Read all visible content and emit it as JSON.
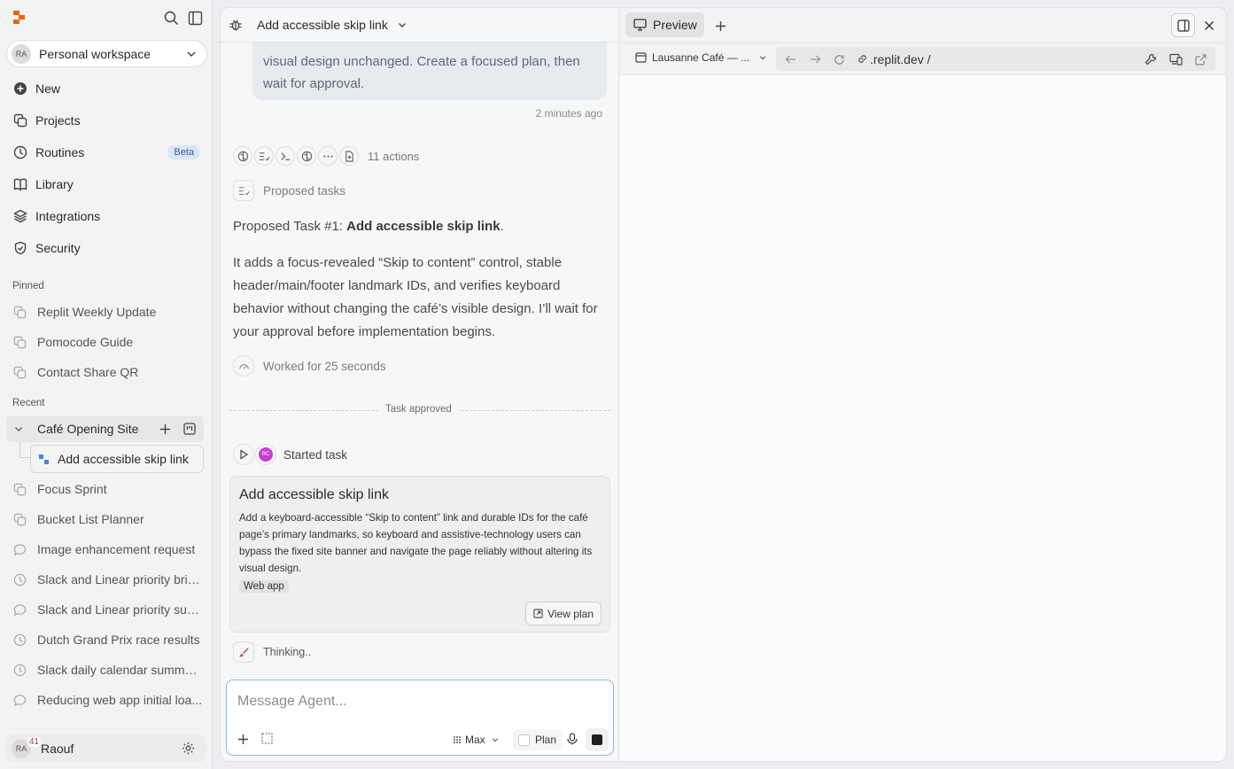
{
  "sidebar": {
    "workspace": {
      "avatar": "RA",
      "label": "Personal workspace"
    },
    "nav": [
      {
        "label": "New",
        "icon": "plus-circle-icon"
      },
      {
        "label": "Projects",
        "icon": "projects-icon"
      },
      {
        "label": "Routines",
        "icon": "clock-icon",
        "badge": "Beta"
      },
      {
        "label": "Library",
        "icon": "book-icon"
      },
      {
        "label": "Integrations",
        "icon": "layers-icon"
      },
      {
        "label": "Security",
        "icon": "shield-icon"
      }
    ],
    "pinned_label": "Pinned",
    "pinned": [
      "Replit Weekly Update",
      "Pomocode Guide",
      "Contact Share QR"
    ],
    "recent_label": "Recent",
    "project": {
      "label": "Café Opening Site",
      "subtask": "Add accessible skip link"
    },
    "recent": [
      {
        "label": "Focus Sprint",
        "icon": "copy-icon"
      },
      {
        "label": "Bucket List Planner",
        "icon": "copy-icon"
      },
      {
        "label": "Image enhancement request",
        "icon": "chat-bubble-icon"
      },
      {
        "label": "Slack and Linear priority brie...",
        "icon": "clock-icon"
      },
      {
        "label": "Slack and Linear priority sum...",
        "icon": "chat-bubble-icon"
      },
      {
        "label": "Dutch Grand Prix race results",
        "icon": "clock-icon"
      },
      {
        "label": "Slack daily calendar summar...",
        "icon": "clock-icon"
      },
      {
        "label": "Reducing web app initial loa...",
        "icon": "chat-bubble-icon"
      }
    ],
    "user": {
      "avatar": "RA",
      "name": "Raouf",
      "notifications": "41"
    }
  },
  "chat": {
    "title": "Add accessible skip link",
    "user_message_tail": "visual design unchanged. Create a focused plan, then wait for approval.",
    "timestamp": "2 minutes ago",
    "actions_count": "11 actions",
    "proposed_tasks_label": "Proposed tasks",
    "proposed_task_prefix": "Proposed Task #1: ",
    "proposed_task_name": "Add accessible skip link",
    "proposed_task_suffix": ".",
    "description": "It adds a focus-revealed “Skip to content” control, stable header/main/footer landmark IDs, and verifies keyboard behavior without changing the café’s visible design. I’ll wait for your approval before implementation begins.",
    "worked_for": "Worked for 25 seconds",
    "approved_label": "Task approved",
    "started_label": "Started task",
    "started_avatar": "RC",
    "task_card": {
      "title": "Add accessible skip link",
      "description": "Add a keyboard-accessible “Skip to content” link and durable IDs for the café page’s primary landmarks, so keyboard and assistive-technology users can bypass the fixed site banner and navigate the page reliably without altering its visual design.",
      "tag": "Web app",
      "button": "View plan"
    },
    "thinking": "Thinking..",
    "input": {
      "placeholder": "Message Agent...",
      "mode": "Max",
      "plan_label": "Plan"
    }
  },
  "preview": {
    "tab_label": "Preview",
    "page_select": "Lausanne Café — ...",
    "url": ".replit.dev /"
  },
  "colors": {
    "accent": "#e2552a",
    "brand": "#f26207",
    "input_border": "#8fb1e6"
  }
}
